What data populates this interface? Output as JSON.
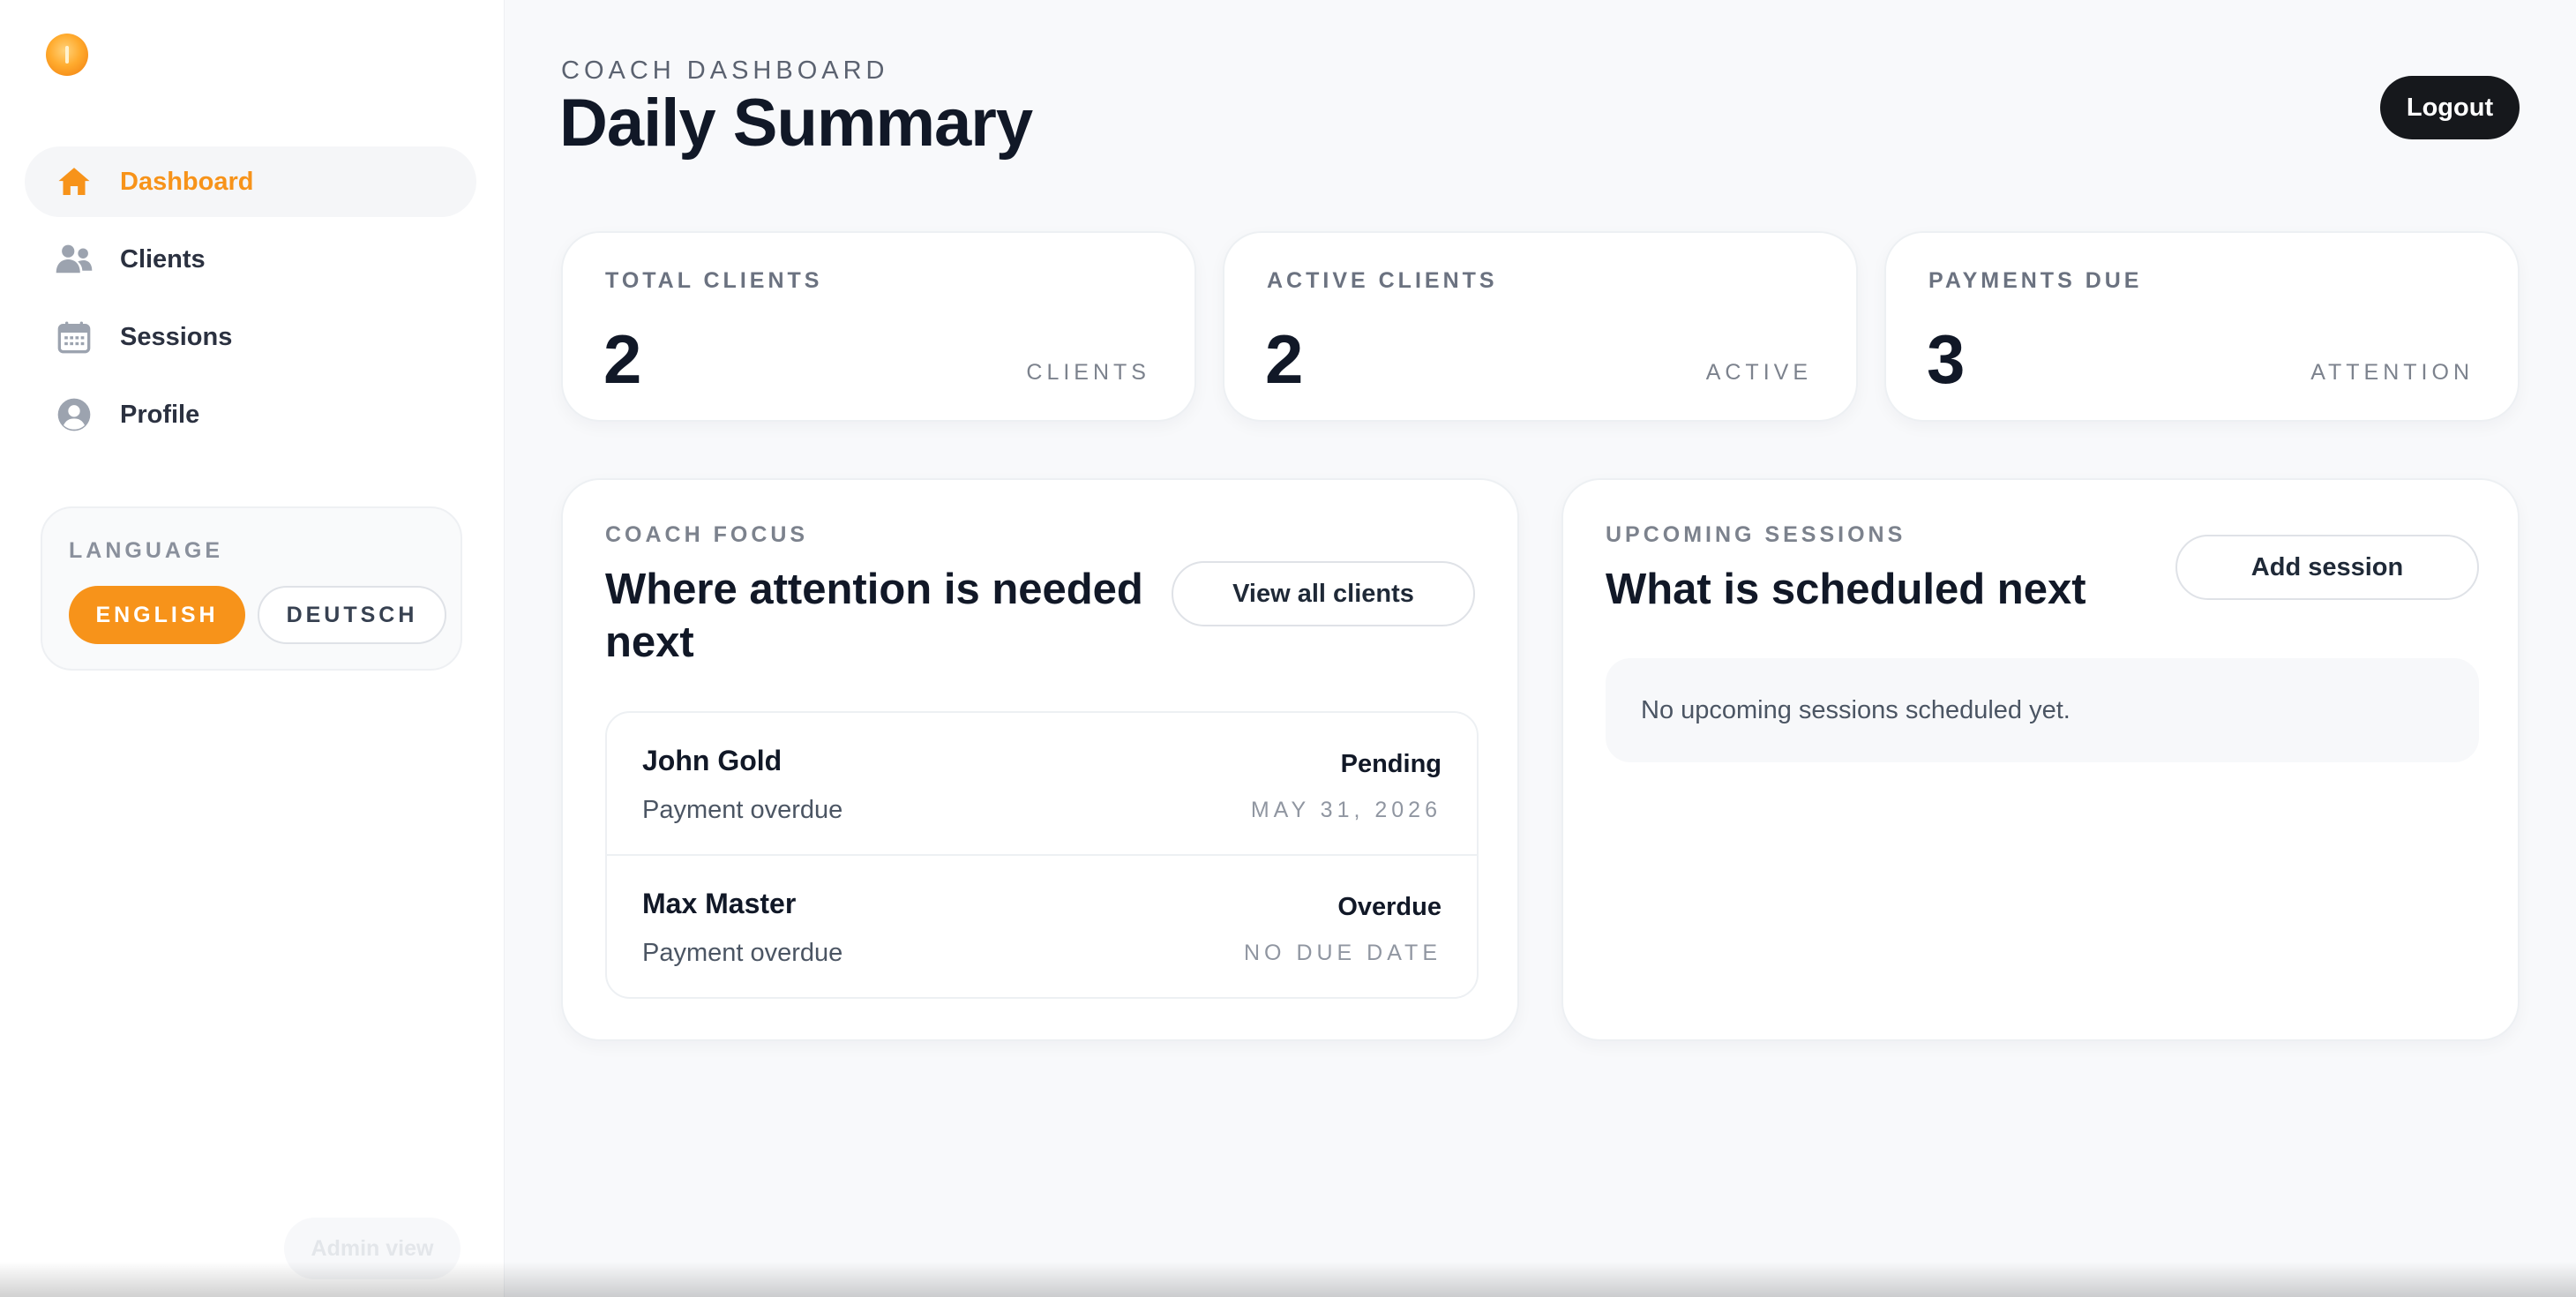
{
  "sidebar": {
    "logo_icon": "sun-logo-icon",
    "nav": [
      {
        "label": "Dashboard",
        "icon": "home-icon",
        "active": true
      },
      {
        "label": "Clients",
        "icon": "users-icon",
        "active": false
      },
      {
        "label": "Sessions",
        "icon": "calendar-icon",
        "active": false
      },
      {
        "label": "Profile",
        "icon": "user-circle-icon",
        "active": false
      }
    ],
    "language": {
      "title": "LANGUAGE",
      "options": [
        "ENGLISH",
        "DEUTSCH"
      ],
      "selected": "ENGLISH"
    },
    "admin_label": "Admin view"
  },
  "header": {
    "eyebrow": "COACH DASHBOARD",
    "title": "Daily Summary",
    "logout_label": "Logout"
  },
  "stats": [
    {
      "label": "TOTAL CLIENTS",
      "value": "2",
      "unit": "CLIENTS"
    },
    {
      "label": "ACTIVE CLIENTS",
      "value": "2",
      "unit": "ACTIVE"
    },
    {
      "label": "PAYMENTS DUE",
      "value": "3",
      "unit": "ATTENTION"
    }
  ],
  "focus": {
    "eyebrow": "COACH FOCUS",
    "title": "Where attention is needed next",
    "button_label": "View all clients",
    "items": [
      {
        "name": "John Gold",
        "detail": "Payment overdue",
        "status": "Pending",
        "date": "MAY 31, 2026"
      },
      {
        "name": "Max Master",
        "detail": "Payment overdue",
        "status": "Overdue",
        "date": "NO DUE DATE"
      }
    ]
  },
  "sessions": {
    "eyebrow": "UPCOMING SESSIONS",
    "title": "What is scheduled next",
    "button_label": "Add session",
    "empty_text": "No upcoming sessions scheduled yet."
  },
  "colors": {
    "accent": "#f7931a",
    "dark_button": "#16181c",
    "background": "#f8f9fb"
  }
}
